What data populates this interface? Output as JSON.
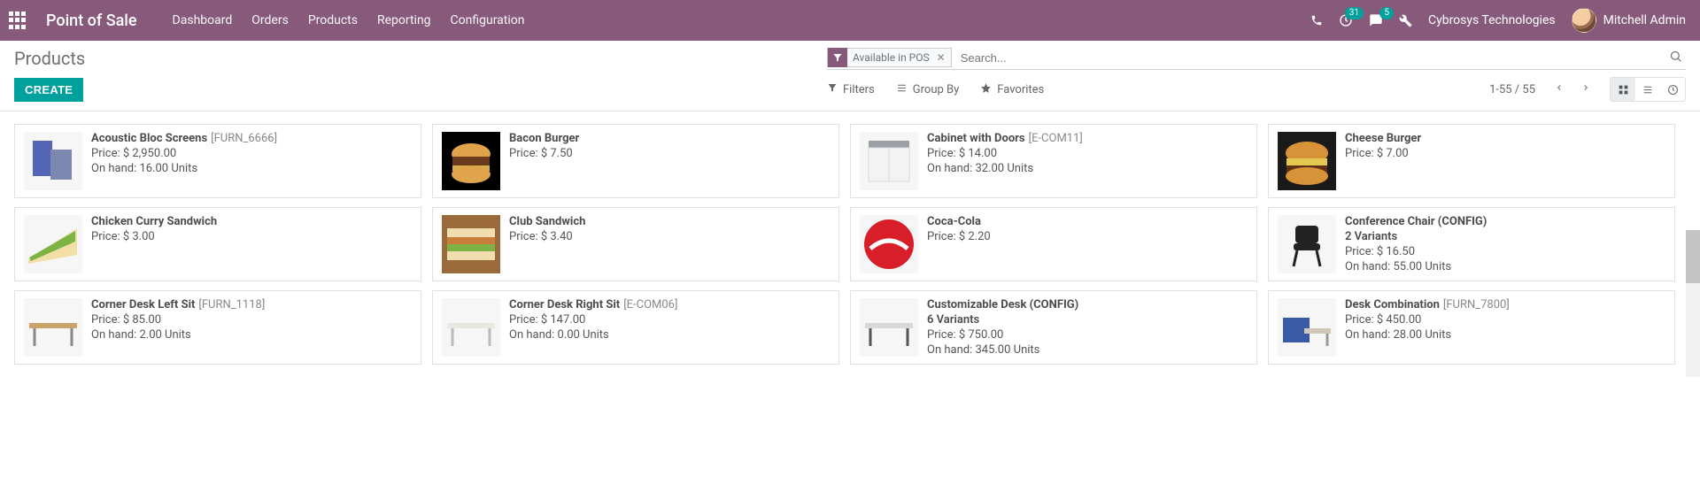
{
  "brand": "Point of Sale",
  "nav": {
    "items": [
      "Dashboard",
      "Orders",
      "Products",
      "Reporting",
      "Configuration"
    ]
  },
  "systray": {
    "clock_badge": "31",
    "chat_badge": "5",
    "company": "Cybrosys Technologies",
    "user": "Mitchell Admin"
  },
  "page": {
    "title": "Products",
    "create_label": "CREATE"
  },
  "search": {
    "facet_label": "Available in POS",
    "placeholder": "Search..."
  },
  "toolbar": {
    "filters": "Filters",
    "groupby": "Group By",
    "favorites": "Favorites"
  },
  "pager": {
    "text": "1-55 / 55"
  },
  "products": [
    {
      "name": "Acoustic Bloc Screens",
      "ref": "[FURN_6666]",
      "price": "Price: $ 2,950.00",
      "onhand": "On hand: 16.00 Units",
      "thumb": "screens"
    },
    {
      "name": "Bacon Burger",
      "ref": "",
      "price": "Price: $ 7.50",
      "onhand": "",
      "thumb": "burger1"
    },
    {
      "name": "Cabinet with Doors",
      "ref": "[E-COM11]",
      "price": "Price: $ 14.00",
      "onhand": "On hand: 32.00 Units",
      "thumb": "cabinet"
    },
    {
      "name": "Cheese Burger",
      "ref": "",
      "price": "Price: $ 7.00",
      "onhand": "",
      "thumb": "burger2"
    },
    {
      "name": "Chicken Curry Sandwich",
      "ref": "",
      "price": "Price: $ 3.00",
      "onhand": "",
      "thumb": "sandwich1"
    },
    {
      "name": "Club Sandwich",
      "ref": "",
      "price": "Price: $ 3.40",
      "onhand": "",
      "thumb": "sandwich2"
    },
    {
      "name": "Coca-Cola",
      "ref": "",
      "price": "Price: $ 2.20",
      "onhand": "",
      "thumb": "cola"
    },
    {
      "name": "Conference Chair (CONFIG)",
      "ref": "",
      "variants": "2 Variants",
      "price": "Price: $ 16.50",
      "onhand": "On hand: 55.00 Units",
      "thumb": "chair"
    },
    {
      "name": "Corner Desk Left Sit",
      "ref": "[FURN_1118]",
      "price": "Price: $ 85.00",
      "onhand": "On hand: 2.00 Units",
      "thumb": "desk1"
    },
    {
      "name": "Corner Desk Right Sit",
      "ref": "[E-COM06]",
      "price": "Price: $ 147.00",
      "onhand": "On hand: 0.00 Units",
      "thumb": "desk2"
    },
    {
      "name": "Customizable Desk (CONFIG)",
      "ref": "",
      "variants": "6 Variants",
      "price": "Price: $ 750.00",
      "onhand": "On hand: 345.00 Units",
      "thumb": "desk3"
    },
    {
      "name": "Desk Combination",
      "ref": "[FURN_7800]",
      "price": "Price: $ 450.00",
      "onhand": "On hand: 28.00 Units",
      "thumb": "deskcombo"
    }
  ]
}
